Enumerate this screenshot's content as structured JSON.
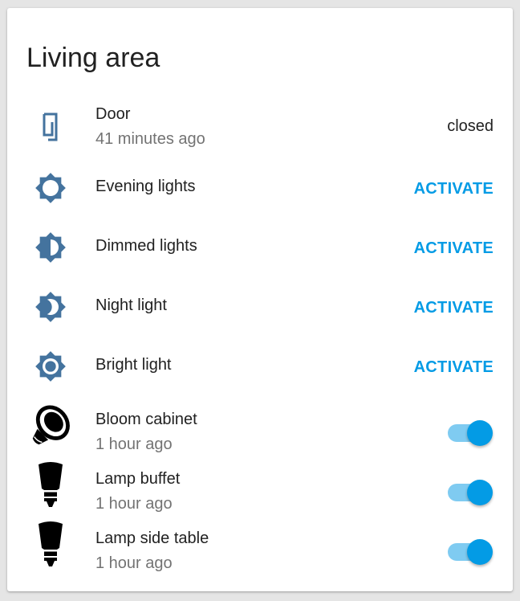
{
  "card": {
    "title": "Living area"
  },
  "entities": [
    {
      "name": "Door",
      "secondary": "41 minutes ago",
      "state": "closed",
      "icon": "door-closed-icon"
    },
    {
      "name": "Evening lights",
      "action": "ACTIVATE",
      "icon": "brightness-5-icon"
    },
    {
      "name": "Dimmed lights",
      "action": "ACTIVATE",
      "icon": "brightness-6-icon"
    },
    {
      "name": "Night light",
      "action": "ACTIVATE",
      "icon": "brightness-4-icon"
    },
    {
      "name": "Bright light",
      "action": "ACTIVATE",
      "icon": "brightness-7-icon"
    },
    {
      "name": "Bloom cabinet",
      "secondary": "1 hour ago",
      "on": true,
      "icon": "hue-bloom-icon"
    },
    {
      "name": "Lamp buffet",
      "secondary": "1 hour ago",
      "on": true,
      "icon": "hue-bulb-icon"
    },
    {
      "name": "Lamp side table",
      "secondary": "1 hour ago",
      "on": true,
      "icon": "hue-bulb-icon"
    }
  ],
  "colors": {
    "accent": "#039be5",
    "icon": "#44739e",
    "toggle_track": "#7fcbf1"
  }
}
